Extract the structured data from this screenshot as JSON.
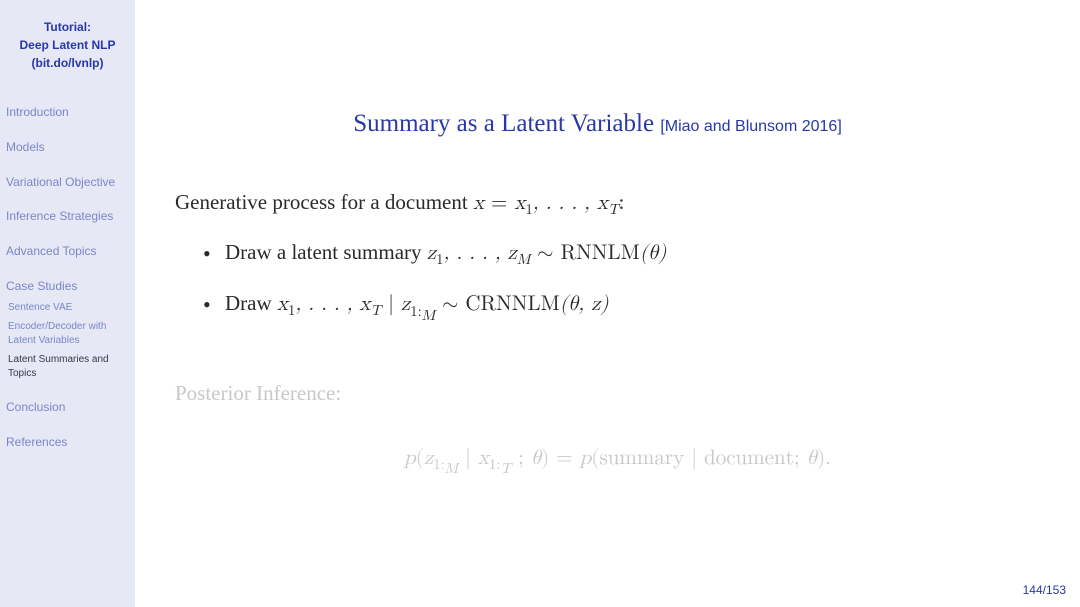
{
  "sidebar": {
    "header": {
      "line1": "Tutorial:",
      "line2": "Deep Latent NLP",
      "line3": "(bit.do/lvnlp)"
    },
    "items": [
      {
        "label": "Introduction"
      },
      {
        "label": "Models"
      },
      {
        "label": "Variational Objective"
      },
      {
        "label": "Inference Strategies"
      },
      {
        "label": "Advanced Topics"
      },
      {
        "label": "Case Studies"
      }
    ],
    "subs": [
      {
        "label": "Sentence VAE",
        "active": false
      },
      {
        "label": "Encoder/Decoder with Latent Variables",
        "active": false
      },
      {
        "label": "Latent Summaries and Topics",
        "active": true
      }
    ],
    "after": [
      {
        "label": "Conclusion"
      },
      {
        "label": "References"
      }
    ]
  },
  "slide": {
    "title_main": "Summary as a Latent Variable",
    "title_cite": "[Miao and Blunsom 2016]",
    "intro_prefix": "Generative process for a document ",
    "bullet1_prefix": "Draw a latent summary ",
    "bullet2_prefix": "Draw ",
    "posterior_label": "Posterior Inference:",
    "rnnlm": "RNNLM",
    "crnnlm": "CRNNLM",
    "summary_word": "summary",
    "document_word": "document"
  },
  "footer": {
    "page": "144/153"
  }
}
